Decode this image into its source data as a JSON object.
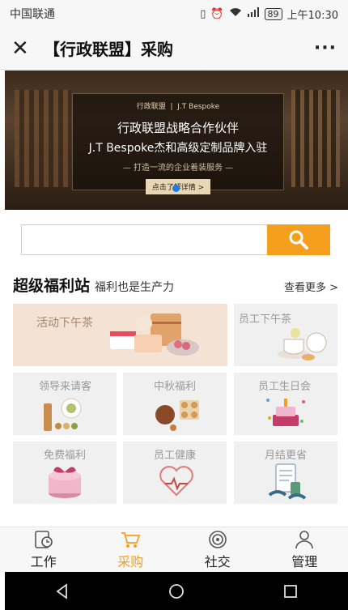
{
  "status": {
    "carrier": "中国联通",
    "battery": "89",
    "time": "上午10:30"
  },
  "titlebar": {
    "title": "【行政联盟】采购"
  },
  "banner": {
    "logo_left": "行政联盟",
    "logo_right": "J.T Bespoke",
    "line1": "行政联盟战略合作伙伴",
    "line2": "J.T Bespoke杰和高级定制品牌入驻",
    "line3": "— 打造一流的企业着装服务 —",
    "button": "点击了解详情 >"
  },
  "search": {
    "placeholder": ""
  },
  "section": {
    "title": "超级福利站",
    "subtitle": "福利也是生产力",
    "more": "查看更多 >"
  },
  "cards": [
    {
      "label": "活动下午茶",
      "icon": "cake-icon"
    },
    {
      "label": "员工下午茶",
      "icon": "tea-icon"
    },
    {
      "label": "领导来请客",
      "icon": "food-icon"
    },
    {
      "label": "中秋福利",
      "icon": "mooncake-icon"
    },
    {
      "label": "员工生日会",
      "icon": "birthday-cake-icon"
    },
    {
      "label": "免费福利",
      "icon": "gift-box-icon"
    },
    {
      "label": "员工健康",
      "icon": "heart-icon"
    },
    {
      "label": "月结更省",
      "icon": "bill-icon"
    }
  ],
  "tabs": [
    {
      "label": "工作",
      "icon": "clock-document-icon"
    },
    {
      "label": "采购",
      "icon": "cart-icon"
    },
    {
      "label": "社交",
      "icon": "target-icon"
    },
    {
      "label": "管理",
      "icon": "person-icon"
    }
  ],
  "colors": {
    "accent": "#f4a01e",
    "card_bg": "#f0f0f0",
    "wide_card_bg": "#f4e3d5",
    "active_dot": "#1f7be0"
  }
}
